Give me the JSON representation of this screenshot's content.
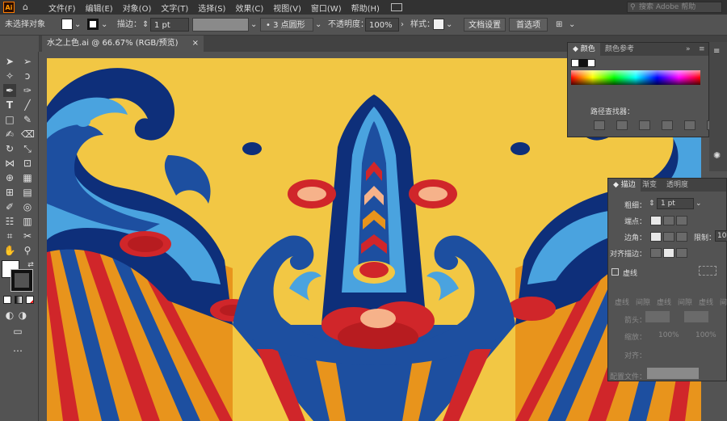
{
  "app": {
    "logo": "Ai",
    "search_placeholder": "搜索 Adobe 帮助"
  },
  "menu": [
    "文件(F)",
    "编辑(E)",
    "对象(O)",
    "文字(T)",
    "选择(S)",
    "效果(C)",
    "视图(V)",
    "窗口(W)",
    "帮助(H)"
  ],
  "control": {
    "selection_status": "未选择对象",
    "stroke_label": "描边：",
    "stroke_value": "1 pt",
    "brush_value": "3 点圆形",
    "opacity_label": "不透明度：",
    "opacity_value": "100%",
    "style_label": "样式：",
    "doc_setup": "文档设置",
    "preferences": "首选项"
  },
  "document": {
    "tab_title": "水之上色.ai @ 66.67% (RGB/预览)"
  },
  "color_panel": {
    "tabs": [
      "颜色",
      "颜色参考"
    ],
    "pathfinder_title": "路径查找器："
  },
  "stroke_panel": {
    "tabs": [
      "描边",
      "渐变",
      "透明度"
    ],
    "weight_label": "粗细：",
    "weight_value": "1 pt",
    "cap_label": "端点：",
    "corner_label": "边角：",
    "limit_label": "限制：",
    "limit_value": "10",
    "align_label": "对齐描边：",
    "dashed_label": "虚线",
    "dash_gap_labels": [
      "虚线",
      "间隙",
      "虚线",
      "间隙",
      "虚线",
      "间隙"
    ],
    "arrow_label": "箭头：",
    "scale_label": "缩放：",
    "scale_values": [
      "100%",
      "100%"
    ],
    "align2_label": "对齐：",
    "profile_label": "配置文件："
  },
  "colors": {
    "accent_yellow": "#f2c744",
    "wave_blue": "#1d4fa0",
    "deep_blue": "#0e2f7a",
    "red": "#d0262a",
    "orange": "#e8941c"
  }
}
